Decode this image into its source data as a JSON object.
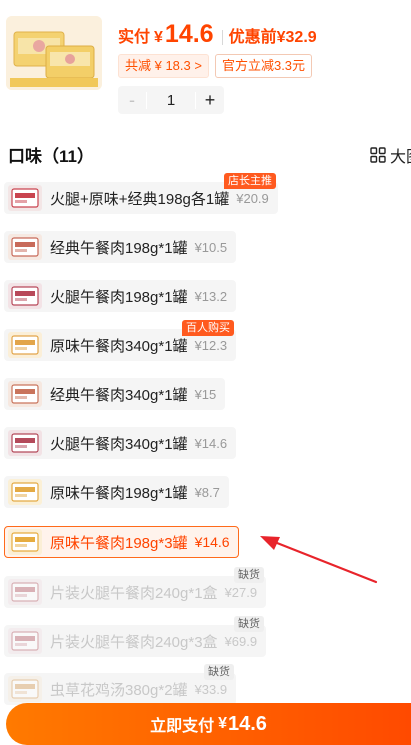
{
  "header": {
    "price_label": "实付",
    "currency": "¥",
    "price": "14.6",
    "original_label": "优惠前",
    "original_price": "32.9",
    "promos": [
      "共减 ¥ 18.3 >",
      "官方立减3.3元"
    ],
    "quantity": "1",
    "minus_symbol": "-",
    "plus_symbol": "+"
  },
  "section": {
    "title": "口味（11）",
    "view_toggle_label": "大图"
  },
  "variants": [
    {
      "name": "火腿+原味+经典198g各1罐",
      "price": "¥20.9",
      "badge": "店长主推"
    },
    {
      "name": "经典午餐肉198g*1罐",
      "price": "¥10.5"
    },
    {
      "name": "火腿午餐肉198g*1罐",
      "price": "¥13.2"
    },
    {
      "name": "原味午餐肉340g*1罐",
      "price": "¥12.3",
      "badge": "百人购买"
    },
    {
      "name": "经典午餐肉340g*1罐",
      "price": "¥15"
    },
    {
      "name": "火腿午餐肉340g*1罐",
      "price": "¥14.6"
    },
    {
      "name": "原味午餐肉198g*1罐",
      "price": "¥8.7"
    },
    {
      "name": "原味午餐肉198g*3罐",
      "price": "¥14.6",
      "selected": true
    },
    {
      "name": "片装火腿午餐肉240g*1盒",
      "price": "¥27.9",
      "badge": "缺货",
      "soldout": true
    },
    {
      "name": "片装火腿午餐肉240g*3盒",
      "price": "¥69.9",
      "badge": "缺货",
      "soldout": true
    },
    {
      "name": "虫草花鸡汤380g*2罐",
      "price": "¥33.9",
      "badge": "缺货",
      "soldout": true
    }
  ],
  "footer": {
    "pay_label": "立即支付",
    "currency": "¥",
    "pay_amount": "14.6"
  },
  "colors": {
    "accent": "#ff4400",
    "selected_border": "#ff6a1a",
    "arrow": "#e8242b",
    "pay_gradient_start": "#ff7a00",
    "pay_gradient_end": "#ff4a00"
  },
  "icons": {
    "view_toggle": "grid-icon",
    "annotation": "arrow-icon"
  }
}
